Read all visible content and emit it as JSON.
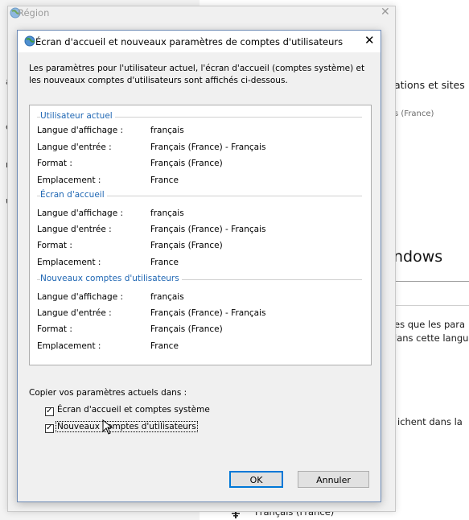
{
  "background_page": {
    "line1": "ations et sites",
    "line2": "s (France)",
    "heading": "ndows",
    "line3": "es que les para",
    "line4": "lans cette langu",
    "line5": "ichent dans la",
    "bottom_lang": "Français (France)",
    "left_chars": [
      "a",
      "e",
      "r",
      "u"
    ]
  },
  "region_window": {
    "title": "Région",
    "close_glyph": "✕"
  },
  "dialog": {
    "title": "Écran d'accueil et nouveaux paramètres de comptes d'utilisateurs",
    "close_glyph": "✕",
    "intro": "Les paramètres pour l'utilisateur actuel, l'écran d'accueil (comptes système) et les nouveaux comptes d'utilisateurs sont affichés ci-dessous.",
    "sections": [
      {
        "title": "Utilisateur actuel",
        "rows": [
          {
            "label": "Langue d'affichage :",
            "value": "français"
          },
          {
            "label": "Langue d'entrée :",
            "value": "Français (France) - Français"
          },
          {
            "label": "Format :",
            "value": "Français (France)"
          },
          {
            "label": "Emplacement :",
            "value": "France"
          }
        ]
      },
      {
        "title": "Écran d'accueil",
        "rows": [
          {
            "label": "Langue d'affichage :",
            "value": "français"
          },
          {
            "label": "Langue d'entrée :",
            "value": "Français (France) - Français"
          },
          {
            "label": "Format :",
            "value": "Français (France)"
          },
          {
            "label": "Emplacement :",
            "value": "France"
          }
        ]
      },
      {
        "title": "Nouveaux comptes d'utilisateurs",
        "rows": [
          {
            "label": "Langue d'affichage :",
            "value": "français"
          },
          {
            "label": "Langue d'entrée :",
            "value": "Français (France) - Français"
          },
          {
            "label": "Format :",
            "value": "Français (France)"
          },
          {
            "label": "Emplacement :",
            "value": "France"
          }
        ]
      }
    ],
    "copy_label": "Copier vos paramètres actuels dans :",
    "checkboxes": [
      {
        "label": "Écran d'accueil et comptes système",
        "checked": true
      },
      {
        "label": "Nouveaux comptes d'utilisateurs",
        "checked": true
      }
    ],
    "ok_label": "OK",
    "cancel_label": "Annuler"
  },
  "colors": {
    "section_title": "#1e66b3",
    "ok_border": "#0078d7",
    "dialog_bg": "#f0f0f0"
  }
}
